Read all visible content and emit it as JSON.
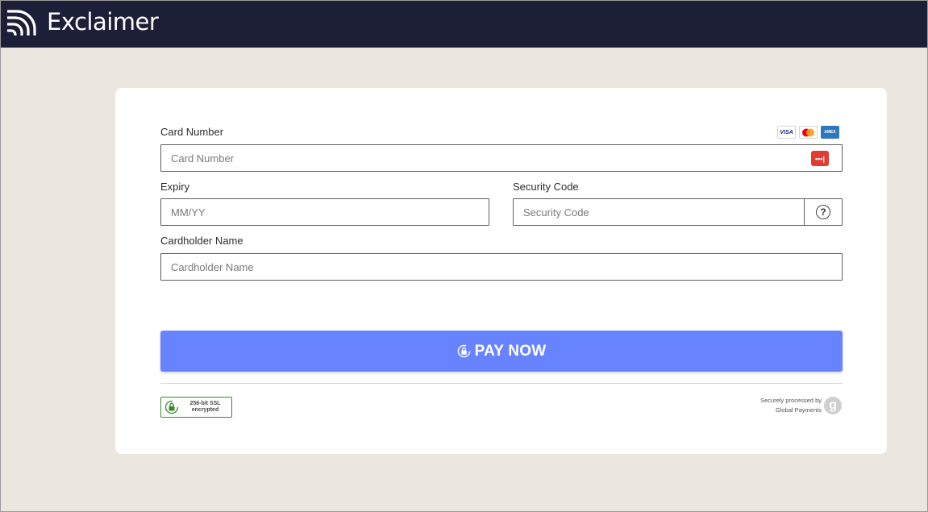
{
  "header": {
    "brand_name": "Exclaimer",
    "logo_icon": "exclaimer-logo-icon"
  },
  "form": {
    "card_number": {
      "label": "Card Number",
      "placeholder": "Card Number",
      "card_brands": [
        "VISA",
        "mastercard",
        "AMEX"
      ],
      "card_icon_text": "•••|"
    },
    "expiry": {
      "label": "Expiry",
      "placeholder": "MM/YY"
    },
    "security_code": {
      "label": "Security Code",
      "placeholder": "Security Code",
      "help_glyph": "?"
    },
    "cardholder_name": {
      "label": "Cardholder Name",
      "placeholder": "Cardholder Name"
    }
  },
  "pay_button": {
    "label": "PAY NOW",
    "color": "#6783ff"
  },
  "footer": {
    "ssl_line1": "256-bit SSL",
    "ssl_line2": "encrypted",
    "processor_line1": "Securely processed by",
    "processor_line2": "Global Payments",
    "processor_logo_glyph": "g"
  },
  "colors": {
    "header_bg": "#1c1f37",
    "page_bg": "#ebe7e0",
    "card_icon": "#e03c31",
    "ssl_green": "#3d8a2f"
  }
}
